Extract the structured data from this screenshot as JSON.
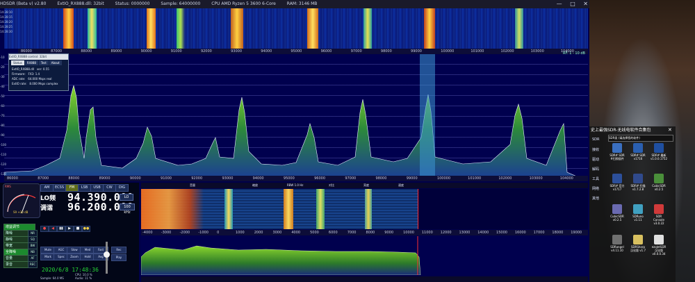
{
  "window": {
    "title_parts": [
      "HDSDR (Beta v) v2.80",
      "ExtIO_RX888.dll: 32bit",
      "Status: 0000000",
      "Sample: 64000000",
      "CPU AMD Ryzen 5 3600 6-Core",
      "RAM: 3146 MB"
    ],
    "min": "—",
    "max": "□",
    "close": "✕"
  },
  "top_waterfall": {
    "time_labels": [
      "14:28:10",
      "14:28:15",
      "14:28:20",
      "14:28:25",
      "14:28:30"
    ],
    "freq_labels": [
      "86000",
      "87000",
      "88000",
      "89000",
      "90000",
      "91000",
      "92000",
      "93000",
      "94000",
      "95000",
      "96000",
      "97000",
      "98000",
      "99000",
      "100000",
      "101000",
      "102000",
      "103000",
      "104000"
    ]
  },
  "spectrum": {
    "step_readout": "RF: 1 - 10 dB",
    "db_labels": [
      "-10",
      "-20",
      "-30",
      "-40",
      "-50",
      "-60",
      "-70",
      "-80",
      "-90",
      "-100",
      "-110",
      "-120",
      "-130"
    ],
    "freq_labels": [
      "86000",
      "87000",
      "88000",
      "89000",
      "90000",
      "91000",
      "92000",
      "93000",
      "94000",
      "95000",
      "96000",
      "97000",
      "98000",
      "99000",
      "100000",
      "101000",
      "102000",
      "103000",
      "104000"
    ]
  },
  "dialog": {
    "title": "ExtIO_RX888 control: 32bit",
    "tabs": [
      "Status",
      "RX888",
      "Test",
      "About"
    ],
    "rows": [
      {
        "k": "ExtIO_RX888.dll",
        "v": "ver:  0.55"
      },
      {
        "k": "Firmware:",
        "v": "FX3: 1.4"
      },
      {
        "k": "ADC rate:",
        "v": "64.000 Msps real"
      },
      {
        "k": "ExtIO rate:",
        "v": "8.000 Msps complex"
      }
    ]
  },
  "meter": {
    "label": "RMS",
    "scale": [
      "1",
      "3",
      "5",
      "7",
      "9",
      "+20",
      "+40"
    ],
    "sub": "S9 +30 dB"
  },
  "modes": [
    "AM",
    "ECSS",
    "FM",
    "LSB",
    "USB",
    "CW",
    "DIG"
  ],
  "active_mode": "FM",
  "lo": {
    "label": "LO频",
    "value": "94.390.000",
    "unit": "LO"
  },
  "tune": {
    "label": "调谐",
    "value": "96.200.000",
    "unit": "100 kHz"
  },
  "side_buttons": [
    {
      "label": "增益调节",
      "value": "",
      "active": true
    },
    {
      "label": "降噪",
      "value": "NR"
    },
    {
      "label": "静噪",
      "value": "SQ"
    },
    {
      "label": "带宽",
      "value": "BW"
    },
    {
      "label": "全降噪",
      "value": "NB",
      "active": true
    },
    {
      "label": "音量",
      "value": "AF"
    },
    {
      "label": "录音",
      "value": "REC"
    }
  ],
  "transport": [
    "●",
    "◀",
    "▮▮",
    "▶",
    "■",
    "●●"
  ],
  "grid_buttons": [
    "Mute",
    "AGC",
    "Slow",
    "Med",
    "Fast",
    "Mark",
    "Spec",
    "Zoom",
    "Hold",
    "Avg"
  ],
  "side_right_buttons": [
    "Rec",
    "Play"
  ],
  "datetime": "2020/6/8 17:48:36",
  "stats": {
    "cpu": "CPU: 10.0  %",
    "audio": "Audio: 11  %",
    "sample": "Sample: 64.0 MS"
  },
  "wf2": {
    "ctl_labels": [
      "音量",
      "缩放",
      "RBW 1.0 Hz",
      "对比",
      "亮度",
      "速度"
    ],
    "freq_labels": [
      "-4000",
      "-3000",
      "-2000",
      "-1000",
      "0",
      "1000",
      "2000",
      "3000",
      "4000",
      "5000",
      "6000",
      "7000",
      "8000",
      "9000",
      "10000",
      "11000",
      "12000",
      "13000",
      "14000",
      "15000",
      "16000",
      "17000",
      "18000",
      "19000"
    ]
  },
  "launcher": {
    "title": "史上最强SDR-无线电软件合集包",
    "categories": [
      "SDR",
      "接收",
      "驱动",
      "解码",
      "工具",
      "网络",
      "其他"
    ],
    "combo": "SDR类 (请选择您的软件)",
    "apps": [
      {
        "name": "SDR# SDR\n#扫频插件",
        "color": "#3a6fc0"
      },
      {
        "name": "SDR# SDR\nv1716",
        "color": "#2a5fb0"
      },
      {
        "name": "SDR# 最新\nv1.0.0.1752",
        "color": "#1f4fa0"
      },
      {
        "name": "SDR# 官方\nv1717",
        "color": "#2c4f9a"
      },
      {
        "name": "SDR# 扫描\nv1.7.2.8",
        "color": "#304a8c"
      },
      {
        "name": "CubicSDR\nv0.2.5",
        "color": "#4a8f3a"
      },
      {
        "name": "CubicSDR\nv0.2.5",
        "color": "#6a6ab0"
      },
      {
        "name": "SDRuno\nv1.11",
        "color": "#40a0c0"
      },
      {
        "name": "SDR\nConsole\nv3.0.22",
        "color": "#d03a3a"
      },
      {
        "name": "SDRangel\nv4.11.10",
        "color": "#707070"
      },
      {
        "name": "SDRSharp\n汉化版 v1.7",
        "color": "#d8c060"
      },
      {
        "name": "ezoJetSDR\n汉化版\nv0.0.0.34",
        "color": "#e0e0e0"
      }
    ]
  },
  "colors": {
    "accent": "#1c8a2e",
    "datetime": "#27d637",
    "marker": "#ff3030"
  }
}
